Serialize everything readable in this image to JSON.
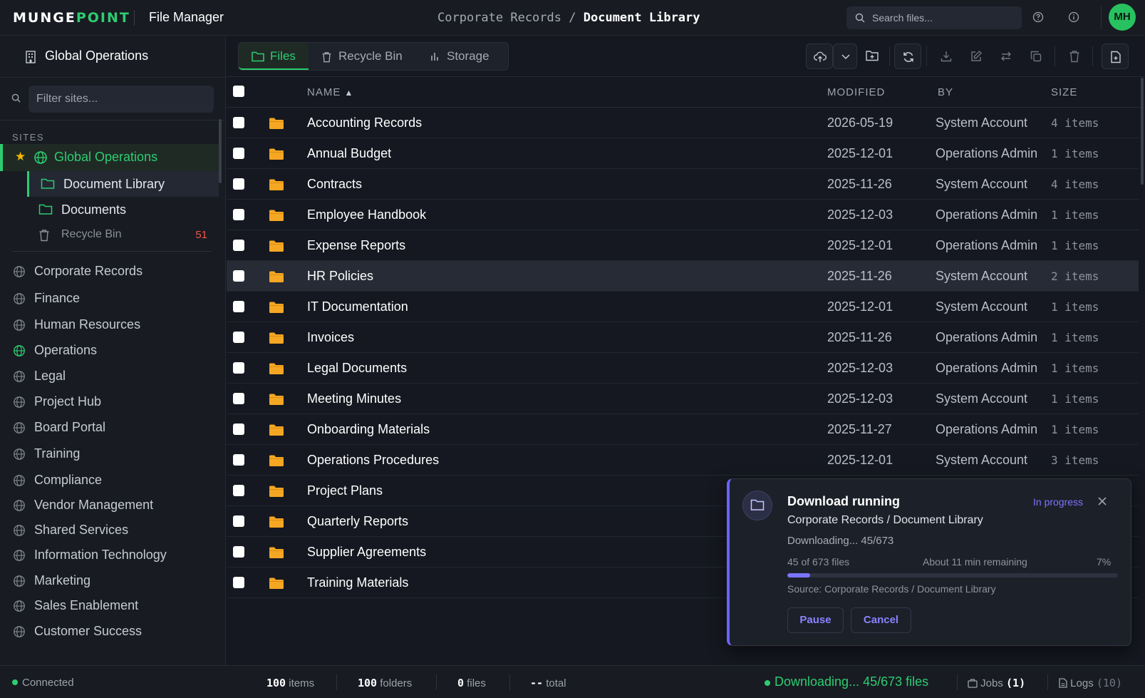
{
  "app": {
    "logo_part1": "MUNGE",
    "logo_part2": "POINT",
    "title": "File Manager",
    "avatar_initials": "MH",
    "accent_color": "#2ecc71"
  },
  "breadcrumb": {
    "parent": "Corporate Records",
    "separator": "/",
    "current": "Document Library"
  },
  "search": {
    "placeholder": "Search files..."
  },
  "sidebar": {
    "header": "Global Operations",
    "filter_placeholder": "Filter sites...",
    "sites_label": "SITES",
    "active_site": "Global Operations",
    "sub_items": [
      {
        "label": "Document Library"
      },
      {
        "label": "Documents"
      },
      {
        "label": "Recycle Bin",
        "count": "51"
      }
    ],
    "sites": [
      {
        "label": "Corporate Records"
      },
      {
        "label": "Finance"
      },
      {
        "label": "Human Resources"
      },
      {
        "label": "Operations"
      },
      {
        "label": "Legal"
      },
      {
        "label": "Project Hub"
      },
      {
        "label": "Board Portal"
      },
      {
        "label": "Training"
      },
      {
        "label": "Compliance"
      },
      {
        "label": "Vendor Management"
      },
      {
        "label": "Shared Services"
      },
      {
        "label": "Information Technology"
      },
      {
        "label": "Marketing"
      },
      {
        "label": "Sales Enablement"
      },
      {
        "label": "Customer Success"
      }
    ]
  },
  "tabs": [
    {
      "label": "Files",
      "icon": "folder-icon"
    },
    {
      "label": "Recycle Bin",
      "icon": "trash-icon"
    },
    {
      "label": "Storage",
      "icon": "bar-chart-icon"
    }
  ],
  "table": {
    "headers": {
      "name": "NAME",
      "sort_indicator": "▲",
      "modified": "MODIFIED",
      "by": "BY",
      "size": "SIZE"
    },
    "rows": [
      {
        "name": "Accounting Records",
        "modified": "2026-05-19",
        "by": "System Account",
        "size": "4 items"
      },
      {
        "name": "Annual Budget",
        "modified": "2025-12-01",
        "by": "Operations Admin",
        "size": "1 items"
      },
      {
        "name": "Contracts",
        "modified": "2025-11-26",
        "by": "System Account",
        "size": "4 items"
      },
      {
        "name": "Employee Handbook",
        "modified": "2025-12-03",
        "by": "Operations Admin",
        "size": "1 items"
      },
      {
        "name": "Expense Reports",
        "modified": "2025-12-01",
        "by": "Operations Admin",
        "size": "1 items"
      },
      {
        "name": "HR Policies",
        "modified": "2025-11-26",
        "by": "System Account",
        "size": "2 items"
      },
      {
        "name": "IT Documentation",
        "modified": "2025-12-01",
        "by": "System Account",
        "size": "1 items"
      },
      {
        "name": "Invoices",
        "modified": "2025-11-26",
        "by": "Operations Admin",
        "size": "1 items"
      },
      {
        "name": "Legal Documents",
        "modified": "2025-12-03",
        "by": "Operations Admin",
        "size": "1 items"
      },
      {
        "name": "Meeting Minutes",
        "modified": "2025-12-03",
        "by": "System Account",
        "size": "1 items"
      },
      {
        "name": "Onboarding Materials",
        "modified": "2025-11-27",
        "by": "Operations Admin",
        "size": "1 items"
      },
      {
        "name": "Operations Procedures",
        "modified": "2025-12-01",
        "by": "System Account",
        "size": "3 items"
      },
      {
        "name": "Project Plans",
        "modified": "",
        "by": "",
        "size": ""
      },
      {
        "name": "Quarterly Reports",
        "modified": "",
        "by": "",
        "size": ""
      },
      {
        "name": "Supplier Agreements",
        "modified": "",
        "by": "",
        "size": ""
      },
      {
        "name": "Training Materials",
        "modified": "",
        "by": "",
        "size": ""
      }
    ]
  },
  "toast": {
    "title": "Download running",
    "status": "In progress",
    "path": "Corporate Records / Document Library",
    "message": "Downloading... 45/673",
    "files_progress": "45 of 673 files",
    "remaining": "About 11 min remaining",
    "percent_label": "7%",
    "progress_fraction": 0.07,
    "source": "Source: Corporate Records / Document Library",
    "pause_label": "Pause",
    "cancel_label": "Cancel",
    "accent_color": "#7b74ff"
  },
  "statusbar": {
    "connection": "Connected",
    "items_count": "100",
    "items_label": "items",
    "folders_count": "100",
    "folders_label": "folders",
    "files_count": "0",
    "files_label": "files",
    "total_value": "--",
    "total_label": "total",
    "download_status": "Downloading... 45/673 files",
    "jobs_label": "Jobs",
    "jobs_count": "(1)",
    "logs_label": "Logs",
    "logs_count": "(10)"
  }
}
